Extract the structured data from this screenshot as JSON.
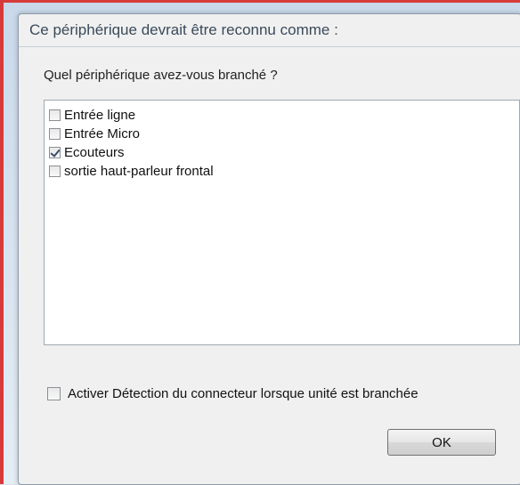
{
  "dialog": {
    "title": "Ce périphérique devrait être reconnu comme :",
    "prompt": "Quel périphérique avez-vous branché ?",
    "devices": [
      {
        "label": "Entrée ligne",
        "checked": false
      },
      {
        "label": "Entrée Micro",
        "checked": false
      },
      {
        "label": "Ecouteurs",
        "checked": true
      },
      {
        "label": "sortie haut-parleur frontal",
        "checked": false
      }
    ],
    "detect_option": {
      "label": "Activer Détection du connecteur lorsque unité est branchée",
      "checked": false
    },
    "ok_label": "OK"
  }
}
